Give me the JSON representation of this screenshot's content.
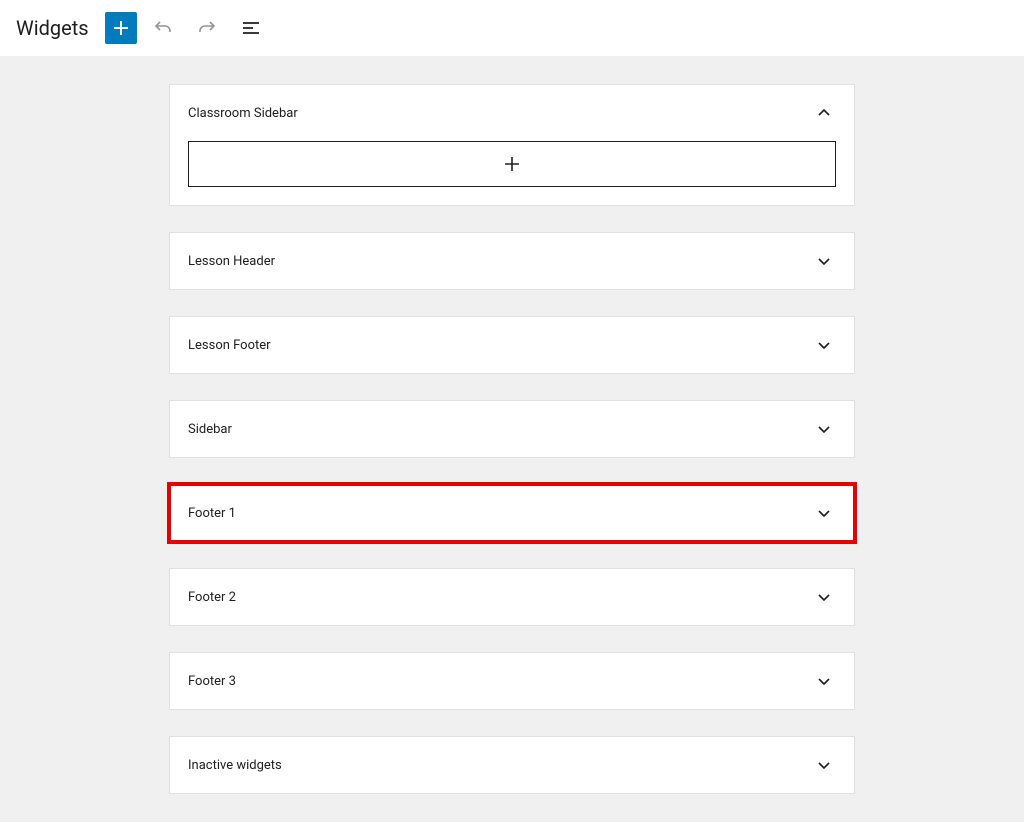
{
  "toolbar": {
    "title": "Widgets"
  },
  "panels": [
    {
      "title": "Classroom Sidebar",
      "expanded": true,
      "highlighted": false
    },
    {
      "title": "Lesson Header",
      "expanded": false,
      "highlighted": false
    },
    {
      "title": "Lesson Footer",
      "expanded": false,
      "highlighted": false
    },
    {
      "title": "Sidebar",
      "expanded": false,
      "highlighted": false
    },
    {
      "title": "Footer 1",
      "expanded": false,
      "highlighted": true
    },
    {
      "title": "Footer 2",
      "expanded": false,
      "highlighted": false
    },
    {
      "title": "Footer 3",
      "expanded": false,
      "highlighted": false
    },
    {
      "title": "Inactive widgets",
      "expanded": false,
      "highlighted": false
    }
  ]
}
